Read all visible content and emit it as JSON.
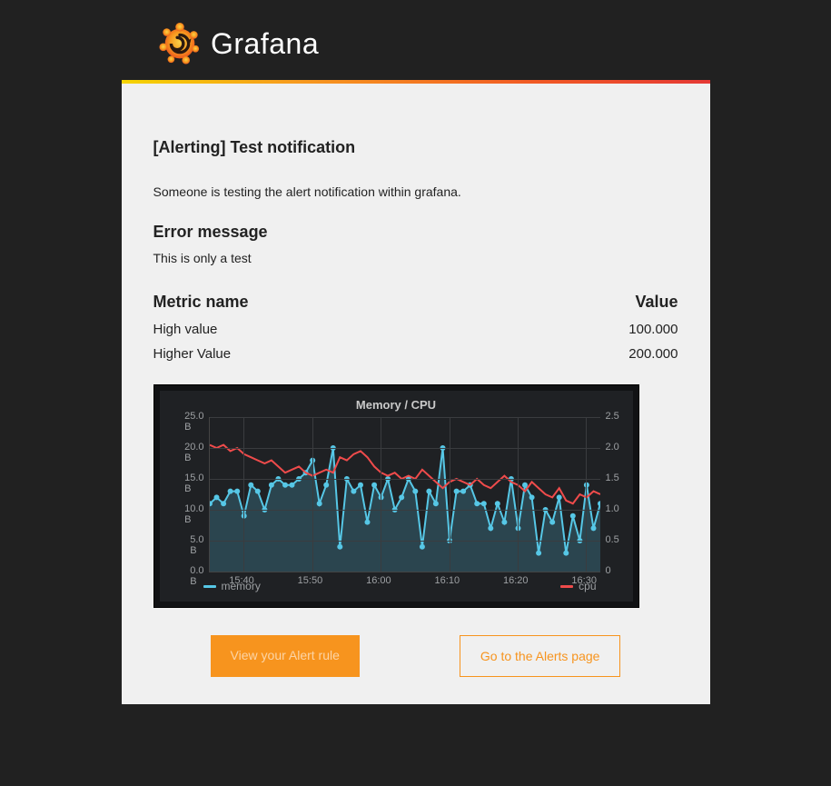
{
  "brand": {
    "name": "Grafana"
  },
  "alert": {
    "title": "[Alerting] Test notification",
    "description": "Someone is testing the alert notification within grafana.",
    "error_heading": "Error message",
    "error_body": "This is only a test"
  },
  "metrics": {
    "header_name": "Metric name",
    "header_value": "Value",
    "rows": [
      {
        "name": "High value",
        "value": "100.000"
      },
      {
        "name": "Higher Value",
        "value": "200.000"
      }
    ]
  },
  "chart_data": {
    "type": "line",
    "title": "Memory / CPU",
    "xlabel": "",
    "ylabel_left": "",
    "ylabel_right": "",
    "x_ticks": [
      "15:40",
      "15:50",
      "16:00",
      "16:10",
      "16:20",
      "16:30"
    ],
    "y_ticks_left": [
      "0.0 B",
      "5.0 B",
      "10.0 B",
      "15.0 B",
      "20.0 B",
      "25.0 B"
    ],
    "y_ticks_right": [
      "0",
      "0.5",
      "1.0",
      "1.5",
      "2.0",
      "2.5"
    ],
    "ylim_left": [
      0,
      25
    ],
    "ylim_right": [
      0,
      2.5
    ],
    "x_minutes": [
      935,
      936,
      937,
      938,
      939,
      940,
      941,
      942,
      943,
      944,
      945,
      946,
      947,
      948,
      949,
      950,
      951,
      952,
      953,
      954,
      955,
      956,
      957,
      958,
      959,
      960,
      961,
      962,
      963,
      964,
      965,
      966,
      967,
      968,
      969,
      970,
      971,
      972,
      973,
      974,
      975,
      976,
      977,
      978,
      979,
      980,
      981,
      982,
      983,
      984,
      985,
      986,
      987,
      988,
      989,
      990,
      991,
      992
    ],
    "series": [
      {
        "name": "memory",
        "axis": "left",
        "color": "#56c7e6",
        "area": true,
        "values": [
          11,
          12,
          11,
          13,
          13,
          9,
          14,
          13,
          10,
          14,
          15,
          14,
          14,
          15,
          16,
          18,
          11,
          14,
          20,
          4,
          15,
          13,
          14,
          8,
          14,
          12,
          15,
          10,
          12,
          15,
          13,
          4,
          13,
          11,
          20,
          5,
          13,
          13,
          14,
          11,
          11,
          7,
          11,
          8,
          15,
          7,
          14,
          12,
          3,
          10,
          8,
          12,
          3,
          9,
          5,
          14,
          7,
          11
        ]
      },
      {
        "name": "cpu",
        "axis": "right",
        "color": "#ef4b4b",
        "area": false,
        "values": [
          2.05,
          2.0,
          2.05,
          1.95,
          2.0,
          1.9,
          1.85,
          1.8,
          1.75,
          1.8,
          1.7,
          1.6,
          1.65,
          1.7,
          1.6,
          1.55,
          1.6,
          1.65,
          1.6,
          1.85,
          1.8,
          1.9,
          1.95,
          1.85,
          1.7,
          1.6,
          1.55,
          1.6,
          1.5,
          1.55,
          1.5,
          1.65,
          1.55,
          1.45,
          1.35,
          1.45,
          1.5,
          1.45,
          1.4,
          1.5,
          1.4,
          1.35,
          1.45,
          1.55,
          1.45,
          1.4,
          1.3,
          1.45,
          1.35,
          1.25,
          1.2,
          1.35,
          1.15,
          1.1,
          1.25,
          1.2,
          1.3,
          1.25
        ]
      }
    ],
    "legend": [
      {
        "name": "memory",
        "color": "#56c7e6"
      },
      {
        "name": "cpu",
        "color": "#ef4b4b"
      }
    ]
  },
  "buttons": {
    "primary": "View your Alert rule",
    "secondary": "Go to the Alerts page"
  }
}
